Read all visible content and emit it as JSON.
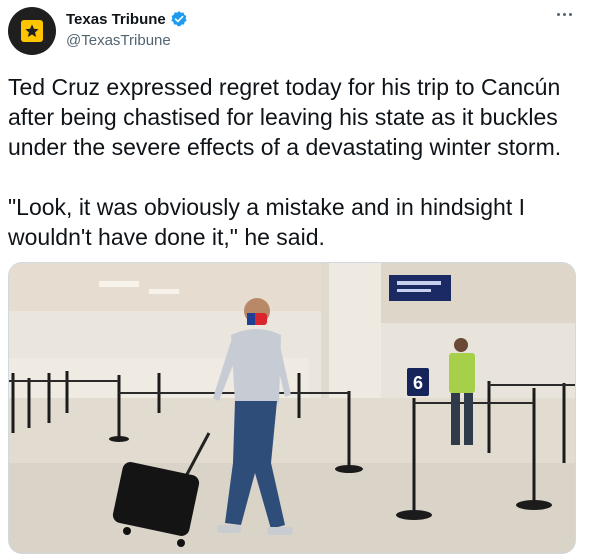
{
  "account": {
    "name": "Texas Tribune",
    "handle": "@TexasTribune",
    "verified": true,
    "avatar_icon": "star-icon",
    "avatar_color": "#1f1f1f",
    "badge_color": "#ffc600",
    "verified_color": "#1d9bf0"
  },
  "tweet": {
    "paragraph_1": "Ted Cruz expressed regret today for his trip to Cancún after being chastised for leaving his state as it buckles under the severe effects of a devastating winter storm.",
    "paragraph_2": "\"Look, it was obviously a mistake and in hindsight I wouldn't have done it,\" he said."
  },
  "photo": {
    "gate_sign_number": "6"
  },
  "icons": {
    "more": "more-options-icon",
    "verified": "verified-badge-icon"
  }
}
